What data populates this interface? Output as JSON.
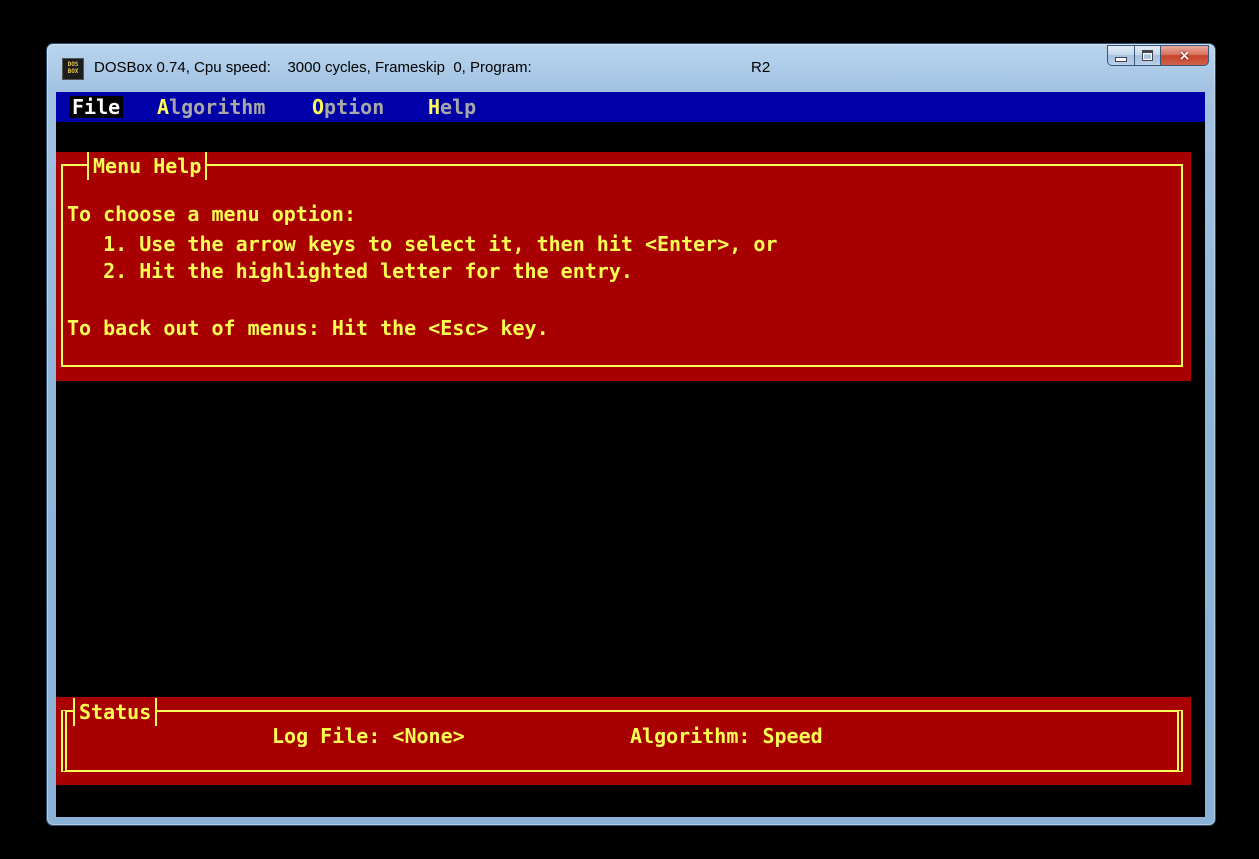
{
  "window": {
    "title": "DOSBox 0.74, Cpu speed:    3000 cycles, Frameskip  0, Program:",
    "program": "R2",
    "icon_text": "DOS BOX"
  },
  "caption_buttons": {
    "minimize": "minimize-icon",
    "maximize": "maximize-icon",
    "close": "×"
  },
  "menu": {
    "file": {
      "label": "File"
    },
    "algorithm": {
      "hot": "A",
      "rest": "lgorithm"
    },
    "option": {
      "hot": "O",
      "rest": "ption"
    },
    "help": {
      "hot": "H",
      "rest": "elp"
    }
  },
  "help_panel": {
    "title": "Menu Help",
    "lines": [
      "To choose a menu option:",
      "   1. Use the arrow keys to select it, then hit <Enter>, or",
      "   2. Hit the highlighted letter for the entry.",
      "To back out of menus: Hit the <Esc> key."
    ]
  },
  "status_panel": {
    "title": "Status",
    "log_file": "Log File: <None>",
    "algorithm": "Algorithm: Speed"
  },
  "colors": {
    "menubar": "#0000a8",
    "panel": "#a80000",
    "text": "#fcfc54"
  }
}
